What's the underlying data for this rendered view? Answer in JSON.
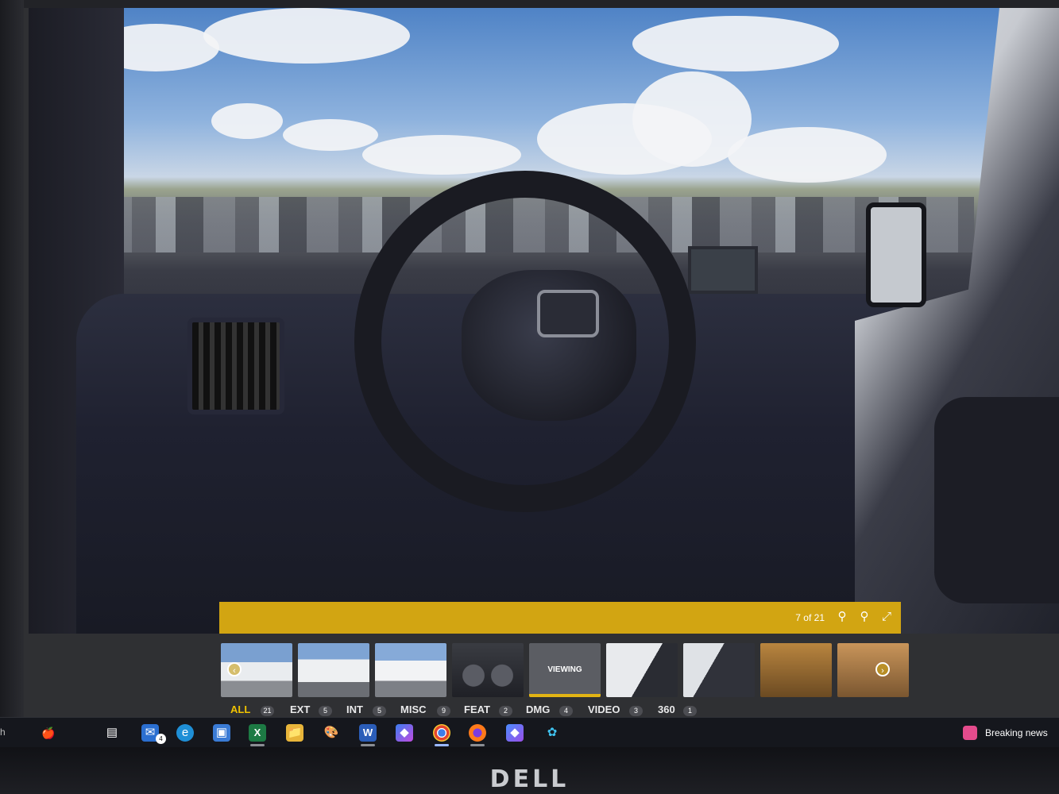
{
  "viewer": {
    "counter": "7 of 21",
    "zoom_out_icon": "zoom-out-icon",
    "zoom_in_icon": "zoom-in-icon",
    "fullscreen_icon": "fullscreen-icon"
  },
  "thumbnails": {
    "active_label": "VIEWING",
    "active_index": 4,
    "count": 9
  },
  "categories": [
    {
      "label": "ALL",
      "count": "21",
      "active": true
    },
    {
      "label": "EXT",
      "count": "5"
    },
    {
      "label": "INT",
      "count": "5"
    },
    {
      "label": "MISC",
      "count": "9"
    },
    {
      "label": "FEAT",
      "count": "2"
    },
    {
      "label": "DMG",
      "count": "4"
    },
    {
      "label": "VIDEO",
      "count": "3"
    },
    {
      "label": "360",
      "count": "1"
    }
  ],
  "taskbar": {
    "edge_text": "h",
    "mail_badge": "4",
    "breaking_news": "Breaking news"
  },
  "monitor": {
    "brand": "DELL"
  },
  "colors": {
    "accent": "#d2a512",
    "active_category": "#f0c200"
  }
}
